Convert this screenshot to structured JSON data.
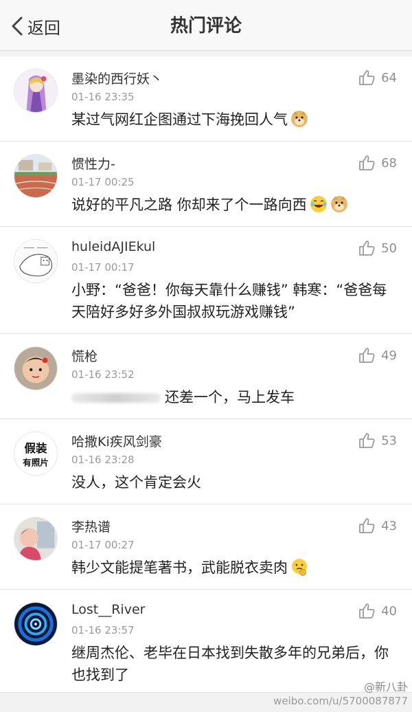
{
  "nav": {
    "back_label": "返回",
    "title": "热门评论"
  },
  "comments": [
    {
      "username": "墨染的西行妖丶",
      "time": "01-16 23:35",
      "likes": "64",
      "text": "某过气网红企图通过下海挽回人气"
    },
    {
      "username": "惯性力-",
      "time": "01-17 00:25",
      "likes": "68",
      "text": "说好的平凡之路 你却来了个一路向西"
    },
    {
      "username": "huleidAJIEkul",
      "time": "01-17 00:17",
      "likes": "50",
      "text": "小野：“爸爸！你每天靠什么赚钱” 韩寒：“爸爸每天陪好多好多外国叔叔玩游戏赚钱”"
    },
    {
      "username": "慌枪",
      "time": "01-16 23:52",
      "likes": "49",
      "text": "还差一个，马上发车"
    },
    {
      "username": "哈撒Ki疾风剑豪",
      "time": "01-16 23:28",
      "likes": "53",
      "text": "没人，这个肯定会火"
    },
    {
      "username": "李热谱",
      "time": "01-17 00:27",
      "likes": "43",
      "text": "韩少文能提笔著书，武能脱衣卖肉"
    },
    {
      "username": "Lost__River",
      "time": "01-16 23:57",
      "likes": "40",
      "text": "继周杰伦、老毕在日本找到失散多年的兄弟后，你也找到了"
    }
  ],
  "avatar_texts": {
    "a5_line1": "假装",
    "a5_line2": "有照片"
  },
  "watermark": {
    "handle": "@新八卦",
    "url": "weibo.com/u/5700087877"
  },
  "colors": {
    "like_gray": "#8f8f8f",
    "time_gray": "#999999",
    "text": "#222222"
  }
}
